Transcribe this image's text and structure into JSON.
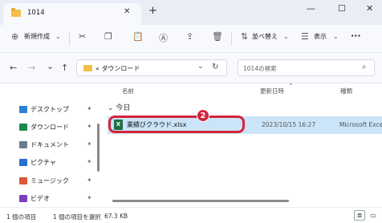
{
  "tab": {
    "title": "1014",
    "close": "✕",
    "new_tab": "+"
  },
  "window": {
    "minimize": "—",
    "maximize": "☐",
    "close": "✕"
  },
  "toolbar": {
    "new_label": "新規作成",
    "new_icon": "⊕",
    "sort_label": "並べ替え",
    "view_label": "表示",
    "more": "···"
  },
  "nav": {
    "back": "←",
    "forward": "→",
    "recent": "⌄",
    "up": "↑"
  },
  "address": {
    "path": "« ダウンロード",
    "dropdown": "⌄",
    "refresh": "↻"
  },
  "search": {
    "placeholder": "1014の検索"
  },
  "sidebar": {
    "items": [
      {
        "label": "デスクトップ",
        "icon": "desktop-icon",
        "color": "#2f7fd6"
      },
      {
        "label": "ダウンロード",
        "icon": "download-icon",
        "color": "#1b8a4f"
      },
      {
        "label": "ドキュメント",
        "icon": "document-icon",
        "color": "#6b7b8f"
      },
      {
        "label": "ピクチャ",
        "icon": "picture-icon",
        "color": "#2b6fd0"
      },
      {
        "label": "ミュージック",
        "icon": "music-icon",
        "color": "#e0573a"
      },
      {
        "label": "ビデオ",
        "icon": "video-icon",
        "color": "#7a3fc0"
      }
    ],
    "pin": "📌"
  },
  "columns": {
    "name": "名前",
    "date": "更新日時",
    "type": "種類"
  },
  "group": {
    "label": "今日",
    "chevron": "⌄"
  },
  "file": {
    "name": "業績びクラウド.xlsx",
    "date": "2023/10/15 16:27",
    "type": "Microsoft Exce",
    "icon_text": "X"
  },
  "callout": {
    "number": "2"
  },
  "status": {
    "count": "1 個の項目",
    "selected": "1 個の項目を選択",
    "size": "67.3 KB"
  },
  "colors": {
    "accent": "#d4243b",
    "selection": "#cce4f7",
    "excel": "#1e7145",
    "folder": "#f2c04a"
  }
}
